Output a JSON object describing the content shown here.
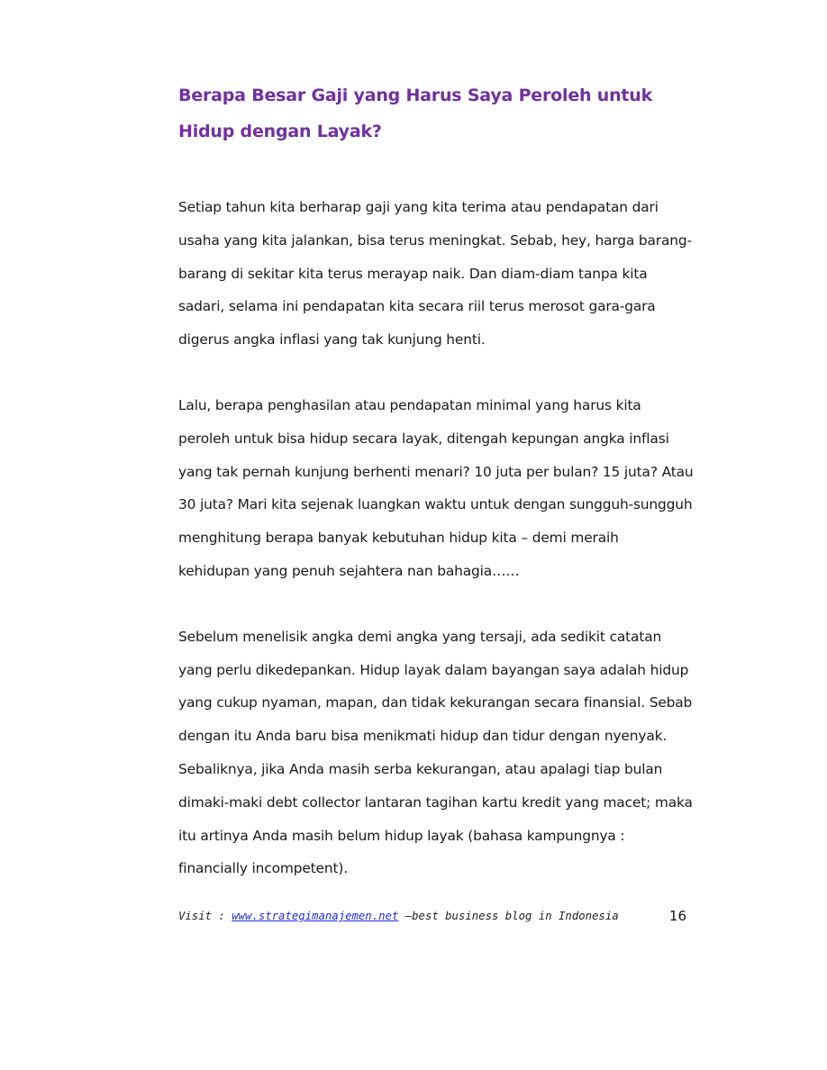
{
  "document": {
    "title": "Berapa Besar Gaji yang Harus Saya Peroleh untuk Hidup dengan Layak?",
    "paragraphs": [
      "Setiap tahun kita berharap gaji yang kita terima atau pendapatan dari usaha yang kita jalankan, bisa terus meningkat. Sebab, hey, harga barang-barang di sekitar kita terus merayap naik. Dan diam-diam tanpa kita sadari, selama ini pendapatan kita secara riil terus merosot gara-gara digerus angka inflasi yang tak kunjung henti.",
      "Lalu, berapa penghasilan atau pendapatan minimal yang harus kita peroleh untuk bisa hidup secara layak, ditengah kepungan angka inflasi yang tak pernah kunjung berhenti menari? 10 juta per bulan? 15 juta? Atau 30 juta? Mari kita sejenak luangkan waktu untuk dengan sungguh-sungguh menghitung berapa banyak kebutuhan hidup kita – demi meraih kehidupan yang penuh sejahtera nan bahagia……",
      "Sebelum menelisik angka demi angka yang tersaji, ada sedikit catatan yang perlu dikedepankan. Hidup layak dalam bayangan saya adalah hidup yang cukup nyaman, mapan, dan tidak kekurangan secara finansial. Sebab dengan itu Anda baru bisa menikmati hidup dan tidur dengan nyenyak. Sebaliknya, jika Anda masih serba kekurangan, atau apalagi tiap bulan dimaki-maki debt collector lantaran tagihan kartu kredit yang macet; maka itu artinya Anda masih belum hidup layak (bahasa kampungnya : financially incompetent)."
    ]
  },
  "footer": {
    "prefix": "Visit : ",
    "link_text": "www.strategimanajemen.net",
    "suffix": " –best business blog in Indonesia",
    "page_number": "16"
  },
  "colors": {
    "title": "#7030a0",
    "link": "#1f2bd6"
  }
}
